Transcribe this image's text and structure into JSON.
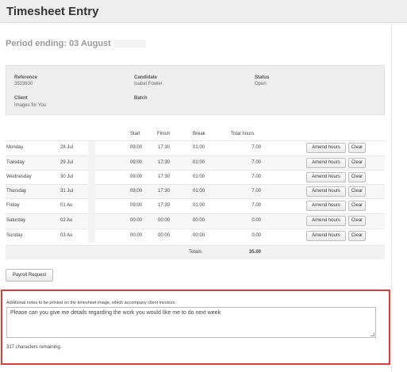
{
  "header": {
    "title": "Timesheet Entry"
  },
  "period": {
    "label": "Period ending: 03 August"
  },
  "info": {
    "reference_label": "Reference",
    "reference_value": "3503630",
    "candidate_label": "Candidate",
    "candidate_value": "Isabel Fowler",
    "status_label": "Status",
    "status_value": "Open",
    "client_label": "Client",
    "client_value": "Images for You",
    "batch_label": "Batch"
  },
  "table": {
    "columns": {
      "start": "Start",
      "finish": "Finish",
      "break": "Break",
      "total": "Total hours"
    },
    "rows": [
      {
        "day": "Monday",
        "date": "28 Jul",
        "start": "09:00",
        "finish": "17:30",
        "break": "01:00",
        "total": "7.00",
        "amend": "Amend hours",
        "clear": "Clear"
      },
      {
        "day": "Tuesday",
        "date": "29 Jul",
        "start": "09:00",
        "finish": "17:30",
        "break": "01:00",
        "total": "7.00",
        "amend": "Amend hours",
        "clear": "Clear"
      },
      {
        "day": "Wednesday",
        "date": "30 Jul",
        "start": "09:00",
        "finish": "17:30",
        "break": "01:00",
        "total": "7.00",
        "amend": "Amend hours",
        "clear": "Clear"
      },
      {
        "day": "Thursday",
        "date": "31 Jul",
        "start": "09:00",
        "finish": "17:30",
        "break": "01:00",
        "total": "7.00",
        "amend": "Amend hours",
        "clear": "Clear"
      },
      {
        "day": "Friday",
        "date": "01 Au",
        "start": "09:00",
        "finish": "17:30",
        "break": "01:00",
        "total": "7.00",
        "amend": "Amend hours",
        "clear": "Clear"
      },
      {
        "day": "Saturday",
        "date": "02 Au",
        "start": "00:00",
        "finish": "00:00",
        "break": "00:00",
        "total": "0.00",
        "amend": "Amend hours",
        "clear": "Clear"
      },
      {
        "day": "Sunday",
        "date": "03 Au",
        "start": "00:00",
        "finish": "00:00",
        "break": "00:00",
        "total": "0.00",
        "amend": "Amend hours",
        "clear": "Clear"
      }
    ],
    "totals_label": "Totals:",
    "totals_value": "35.00"
  },
  "payroll_button": "Payroll Request",
  "notes": {
    "label": "Additional notes to be printed on the timesheet image, which accompany client invoices.",
    "value": "Please can you give me details regarding the work you would like me to do next week",
    "remaining": "317 characters remaining."
  }
}
